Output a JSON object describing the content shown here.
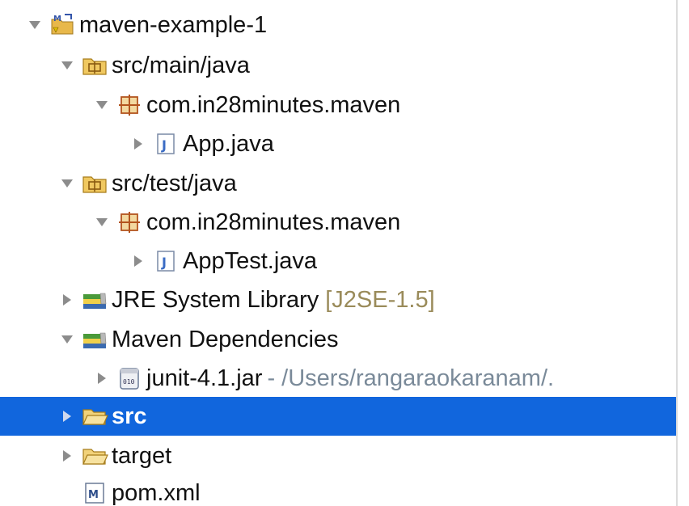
{
  "tree": {
    "selected_label": "src",
    "items": [
      {
        "label": "maven-example-1",
        "expanded": true,
        "icon": "maven-project-icon"
      },
      {
        "label": "src/main/java",
        "expanded": true,
        "icon": "source-folder-icon"
      },
      {
        "label": "com.in28minutes.maven",
        "expanded": true,
        "icon": "package-icon"
      },
      {
        "label": "App.java",
        "expanded": false,
        "icon": "java-file-icon"
      },
      {
        "label": "src/test/java",
        "expanded": true,
        "icon": "source-folder-icon"
      },
      {
        "label": "com.in28minutes.maven",
        "expanded": true,
        "icon": "package-icon"
      },
      {
        "label": "AppTest.java",
        "expanded": false,
        "icon": "java-file-icon"
      },
      {
        "label": "JRE System Library",
        "decoration": "[J2SE-1.5]",
        "expanded": false,
        "icon": "library-icon"
      },
      {
        "label": "Maven Dependencies",
        "expanded": true,
        "icon": "library-icon"
      },
      {
        "label": "junit-4.1.jar",
        "decoration": "- /Users/rangaraokaranam/.",
        "expanded": false,
        "icon": "jar-icon"
      },
      {
        "label": "src",
        "expanded": false,
        "selected": true,
        "icon": "folder-icon"
      },
      {
        "label": "target",
        "expanded": false,
        "icon": "folder-icon"
      },
      {
        "label": "pom.xml",
        "icon": "maven-pom-icon"
      }
    ]
  },
  "colors": {
    "selection": "#1166dd",
    "decoration": "#9a8b5a",
    "path_decoration": "#7a8a99"
  }
}
